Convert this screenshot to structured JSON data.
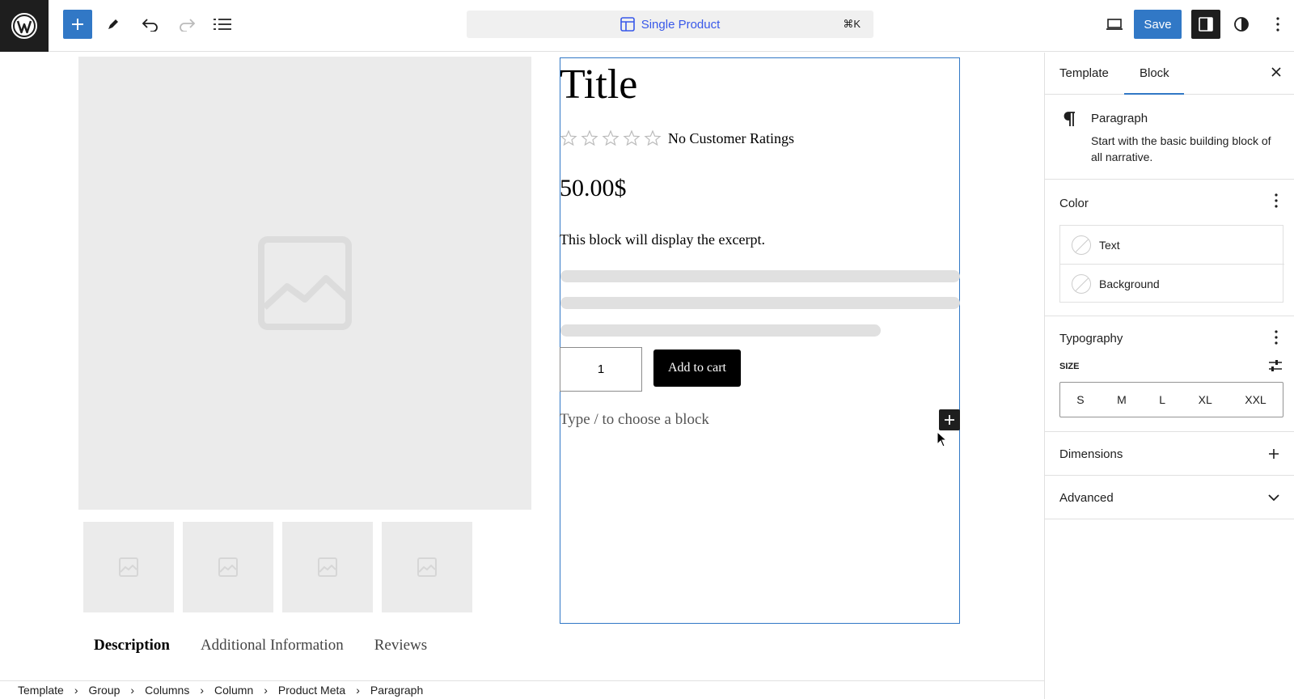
{
  "topbar": {
    "command_title": "Single Product",
    "command_shortcut": "⌘K",
    "save_label": "Save"
  },
  "canvas": {
    "product_title": "Title",
    "rating_text": "No Customer Ratings",
    "price": "50.00$",
    "excerpt": "This block will display the excerpt.",
    "quantity": "1",
    "add_to_cart": "Add to cart",
    "block_placeholder": "Type / to choose a block",
    "tabs": [
      "Description",
      "Additional Information",
      "Reviews"
    ]
  },
  "breadcrumb": [
    "Template",
    "Group",
    "Columns",
    "Column",
    "Product Meta",
    "Paragraph"
  ],
  "sidebar": {
    "tabs": [
      "Template",
      "Block"
    ],
    "block_name": "Paragraph",
    "block_description": "Start with the basic building block of all narrative.",
    "color": {
      "title": "Color",
      "items": [
        "Text",
        "Background"
      ]
    },
    "typography": {
      "title": "Typography",
      "size_label": "SIZE",
      "sizes": [
        "S",
        "M",
        "L",
        "XL",
        "XXL"
      ]
    },
    "dimensions_title": "Dimensions",
    "advanced_title": "Advanced"
  },
  "colors": {
    "accent": "#3178c6",
    "dark": "#1e1e1e",
    "command_text": "#3858e9"
  }
}
